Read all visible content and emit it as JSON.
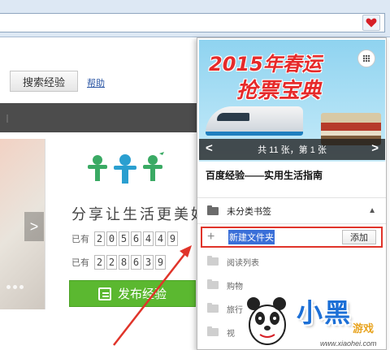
{
  "browser": {
    "bookmark_heart_icon": "heart-icon"
  },
  "page": {
    "search_button": "搜索经验",
    "help_link": "帮助",
    "slogan": "分享让生活更美好",
    "counter1_label": "已有",
    "counter1_digits": [
      "2",
      "0",
      "5",
      "6",
      "4",
      "4",
      "9"
    ],
    "counter2_label": "已有",
    "counter2_digits": [
      "2",
      "2",
      "8",
      "6",
      "3",
      "9"
    ],
    "publish_button": "发布经验"
  },
  "popup": {
    "banner_line1": "2015年春运",
    "banner_line2": "抢票宝典",
    "slide_info": "共 11 张，第 1 张",
    "slide_prev": "<",
    "slide_next": ">",
    "site_title": "百度经验——实用生活指南",
    "folder_name": "未分类书签",
    "new_folder_input": "新建文件夹",
    "add_button": "添加",
    "items": [
      {
        "label": "阅读列表"
      },
      {
        "label": "购物"
      },
      {
        "label": "旅行"
      },
      {
        "label": "视"
      }
    ]
  },
  "watermark": {
    "brand": "小黑",
    "game": "游戏",
    "url": "www.xiaohei.com"
  },
  "colors": {
    "accent_red": "#e0342a",
    "publish_green": "#5bb830",
    "selection_blue": "#3a6fd8"
  }
}
